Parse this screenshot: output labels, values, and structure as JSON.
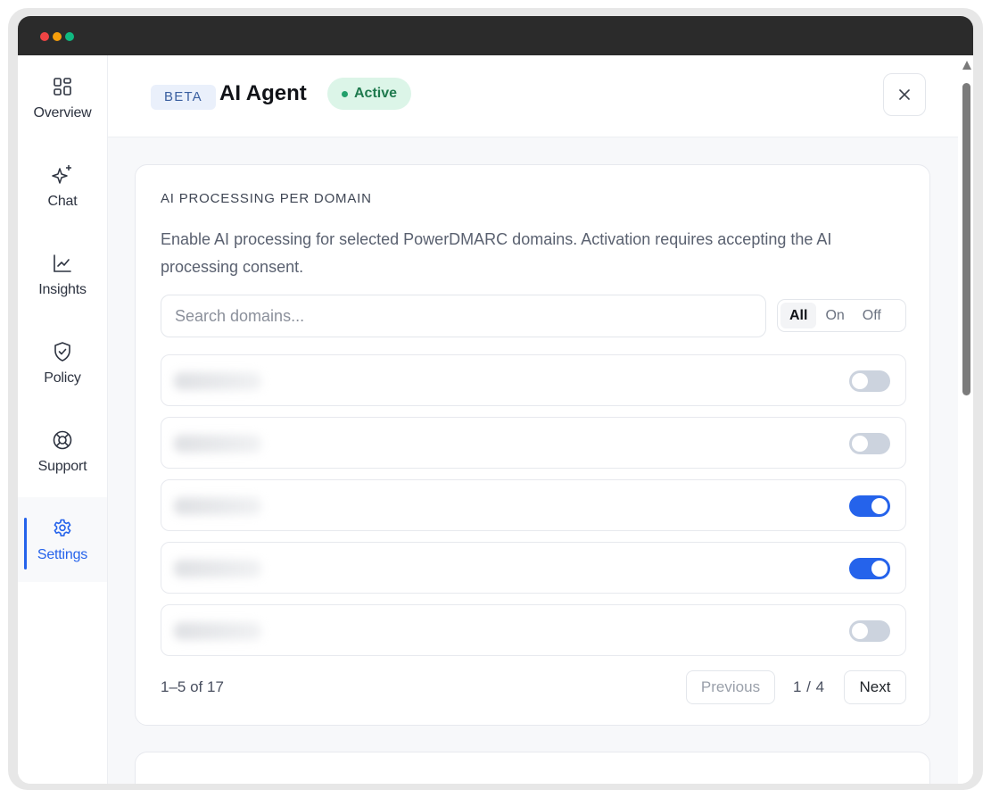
{
  "window": {
    "traffic_lights": {
      "close": "#ef4444",
      "minimize": "#f59e0b",
      "maximize": "#10b981"
    }
  },
  "sidebar": {
    "items": [
      {
        "label": "Overview",
        "icon": "grid-icon"
      },
      {
        "label": "Chat",
        "icon": "sparkles-icon"
      },
      {
        "label": "Insights",
        "icon": "chart-line-icon"
      },
      {
        "label": "Policy",
        "icon": "shield-check-icon"
      },
      {
        "label": "Support",
        "icon": "lifebuoy-icon"
      },
      {
        "label": "Settings",
        "icon": "gear-icon",
        "active": true
      }
    ]
  },
  "header": {
    "badge": "BETA",
    "title": "AI Agent",
    "status": "Active",
    "close_icon": "close-icon"
  },
  "processing": {
    "heading": "AI PROCESSING PER DOMAIN",
    "description": "Enable AI processing for selected PowerDMARC domains. Activation requires accepting the AI processing consent.",
    "search_placeholder": "Search domains...",
    "filters": [
      "All",
      "On",
      "Off"
    ],
    "selected_filter": "All",
    "domains": [
      {
        "enabled": false
      },
      {
        "enabled": false
      },
      {
        "enabled": true
      },
      {
        "enabled": true
      },
      {
        "enabled": false
      }
    ],
    "pagination": {
      "count": "1–5 of 17",
      "previous": "Previous",
      "page": "1 / 4",
      "next": "Next"
    }
  },
  "colors": {
    "accent": "#2563eb",
    "status_bg": "#dcf5e8",
    "status_text": "#1f7a4e",
    "toggle_off": "#ccd3de"
  }
}
